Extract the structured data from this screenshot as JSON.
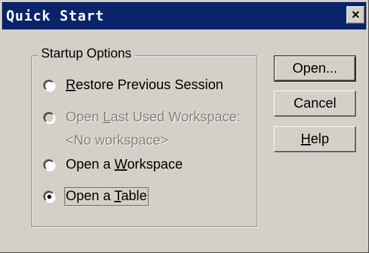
{
  "window": {
    "title": "Quick Start",
    "close_label": "×"
  },
  "startup": {
    "group_label": "Startup Options",
    "options": [
      {
        "pre": "",
        "u": "R",
        "post": "estore Previous Session",
        "enabled": true,
        "checked": false
      },
      {
        "pre": "Open ",
        "u": "L",
        "post": "ast Used Workspace:",
        "enabled": false,
        "checked": false
      },
      {
        "pre": "Open a ",
        "u": "W",
        "post": "orkspace",
        "enabled": true,
        "checked": false
      },
      {
        "pre": "Open a ",
        "u": "T",
        "post": "able",
        "enabled": true,
        "checked": true
      }
    ],
    "last_workspace_value": "<No workspace>"
  },
  "buttons": {
    "open": "Open...",
    "cancel": "Cancel",
    "help_pre": "",
    "help_u": "H",
    "help_post": "elp"
  }
}
